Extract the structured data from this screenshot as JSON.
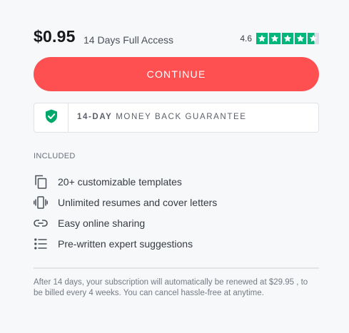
{
  "offer": {
    "price": "$0.95",
    "access": "14 Days Full Access",
    "rating": "4.6",
    "rating_stars": 4.6,
    "star_color": "#00b67a"
  },
  "cta": {
    "label": "CONTINUE",
    "color": "#ff5051"
  },
  "guarantee": {
    "bold": "14-DAY",
    "rest": " MONEY BACK GUARANTEE",
    "icon": "shield-check-icon"
  },
  "included": {
    "heading": "INCLUDED",
    "items": [
      {
        "label": "20+ customizable templates",
        "icon": "copy-icon"
      },
      {
        "label": "Unlimited resumes and cover letters",
        "icon": "vibrate-icon"
      },
      {
        "label": "Easy online sharing",
        "icon": "link-icon"
      },
      {
        "label": "Pre-written expert suggestions",
        "icon": "list-icon"
      }
    ]
  },
  "footnote": "After 14 days, your subscription will automatically be renewed at $29.95 , to be billed every 4 weeks. You can cancel hassle-free at anytime."
}
